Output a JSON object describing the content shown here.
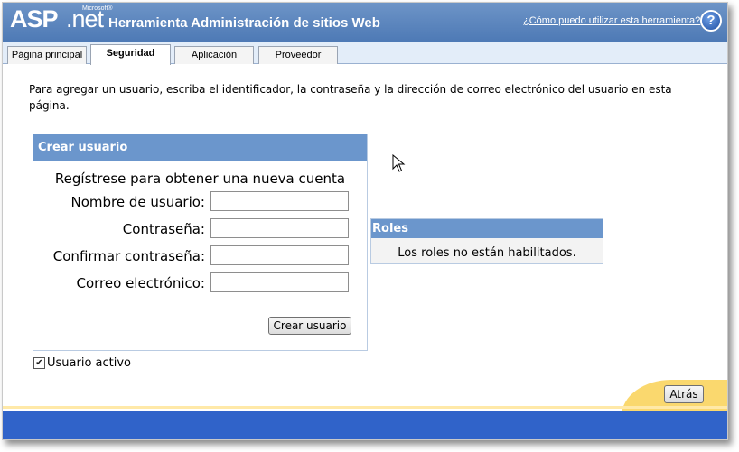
{
  "header": {
    "logo_asp": "ASP",
    "logo_net": ".net",
    "logo_ms": "Microsoft®",
    "title": "Herramienta Administración de sitios Web",
    "help_link": "¿Cómo puedo utilizar esta herramienta?",
    "help_icon_glyph": "?"
  },
  "tabs": [
    {
      "label": "Página principal",
      "active": false
    },
    {
      "label": "Seguridad",
      "active": true
    },
    {
      "label": "Aplicación",
      "active": false
    },
    {
      "label": "Proveedor",
      "active": false
    }
  ],
  "intro": "Para agregar un usuario, escriba el identificador, la contraseña y la dirección de correo electrónico del usuario en esta página.",
  "create_user": {
    "header": "Crear usuario",
    "subtitle": "Regístrese para obtener una nueva cuenta",
    "fields": [
      {
        "label": "Nombre de usuario:",
        "value": ""
      },
      {
        "label": "Contraseña:",
        "value": ""
      },
      {
        "label": "Confirmar contraseña:",
        "value": ""
      },
      {
        "label": "Correo electrónico:",
        "value": ""
      }
    ],
    "button": "Crear usuario"
  },
  "active_user": {
    "label": "Usuario activo",
    "checked": true,
    "check_glyph": "✔"
  },
  "roles": {
    "header": "Roles",
    "text": "Los roles no están habilitados."
  },
  "footer": {
    "back_button": "Atrás"
  },
  "colors": {
    "header_blue": "#5b86c0",
    "panel_header": "#6b96cc",
    "footer_blue": "#3063c9",
    "footer_yellow": "#fad86e"
  }
}
